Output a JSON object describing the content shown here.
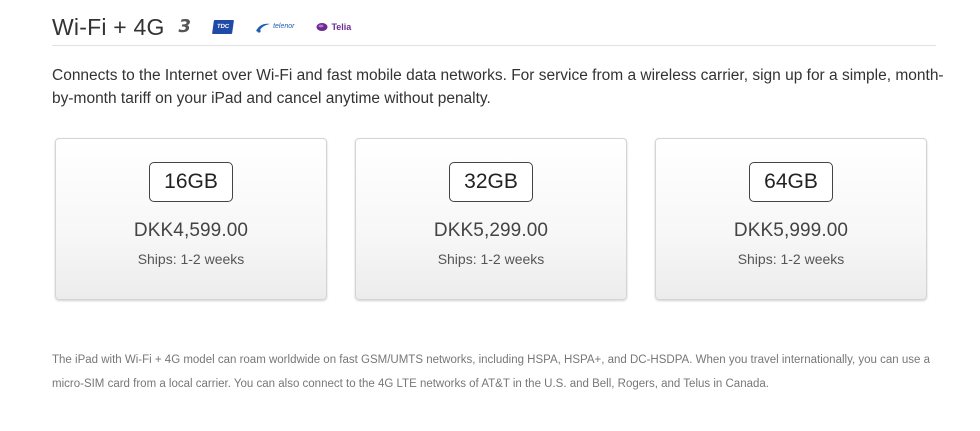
{
  "header": {
    "title": "Wi-Fi + 4G",
    "carriers": [
      {
        "name": "3",
        "icon": "three-logo",
        "color": "#555555"
      },
      {
        "name": "TDC",
        "icon": "tdc-logo",
        "color": "#1f4aa8"
      },
      {
        "name": "telenor",
        "icon": "telenor-logo",
        "color": "#1f5fb3"
      },
      {
        "name": "Telia",
        "icon": "telia-logo",
        "color": "#6b2c91"
      }
    ]
  },
  "intro": "Connects to the Internet over Wi-Fi and fast mobile data networks. For service from a wireless carrier, sign up for a simple, month-by-month tariff on your iPad and cancel anytime without penalty.",
  "options": [
    {
      "capacity": "16GB",
      "price": "DKK4,599.00",
      "shipping": "Ships: 1-2 weeks"
    },
    {
      "capacity": "32GB",
      "price": "DKK5,299.00",
      "shipping": "Ships: 1-2 weeks"
    },
    {
      "capacity": "64GB",
      "price": "DKK5,999.00",
      "shipping": "Ships: 1-2 weeks"
    }
  ],
  "footnote": "The iPad with Wi-Fi + 4G model can roam worldwide on fast GSM/UMTS networks, including HSPA, HSPA+, and DC-HSDPA. When you travel internationally, you can use a micro-SIM card from a local carrier. You can also connect to the 4G LTE networks of AT&T in the U.S. and Bell, Rogers, and Telus in Canada."
}
